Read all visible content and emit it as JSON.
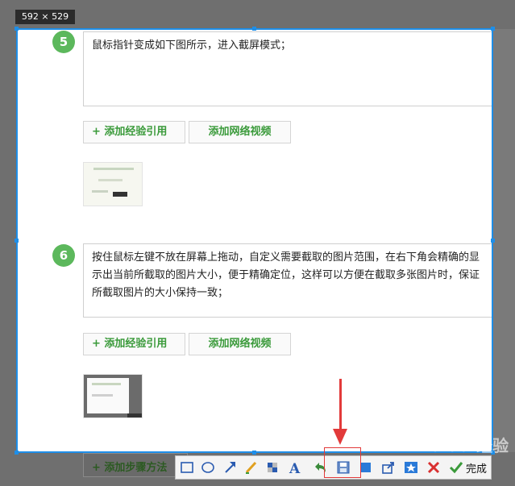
{
  "selection_size": "592 × 529",
  "steps": [
    {
      "number": "5",
      "text": "鼠标指针变成如下图所示，进入截屏模式；"
    },
    {
      "number": "6",
      "text": "按住鼠标左键不放在屏幕上拖动，自定义需要截取的图片范围，在右下角会精确的显示出当前所截取的图片大小，便于精确定位，这样可以方便在截取多张图片时，保证所截取图片的大小保持一致；"
    }
  ],
  "buttons": {
    "add_experience": "+ 添加经验引用",
    "add_video": "添加网络视频",
    "add_step_method": "+ 添加步骤方法"
  },
  "toolbar": {
    "done_label": "完成",
    "icons": [
      "rectangle-icon",
      "ellipse-icon",
      "arrow-icon",
      "pen-icon",
      "mosaic-icon",
      "text-icon",
      "undo-icon",
      "save-icon",
      "copy-icon",
      "share-icon",
      "pin-icon",
      "cancel-icon",
      "done-icon"
    ]
  },
  "watermark": "Baidu 经验",
  "colors": {
    "selection_border": "#1e8ee8",
    "accent_green": "#5cb85c",
    "annotation_red": "#e23a3a"
  }
}
